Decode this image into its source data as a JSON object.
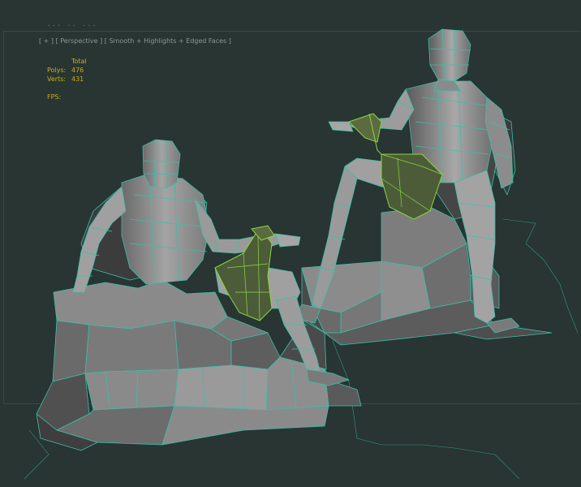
{
  "toolbar": {
    "label": "···  ··  ···"
  },
  "viewport": {
    "label": "[ + ] [ Perspective ] [ Smooth + Highlights + Edged Faces ]"
  },
  "stats": {
    "header": "Total",
    "polys_label": "Polys:",
    "polys_value": "476",
    "verts_label": "Verts:",
    "verts_value": "431",
    "fps_label": "FPS:"
  },
  "colors": {
    "background": "#283532",
    "wireframe": "#3ac0a8",
    "selection": "#8cd640",
    "stats_text": "#c8b01a"
  }
}
